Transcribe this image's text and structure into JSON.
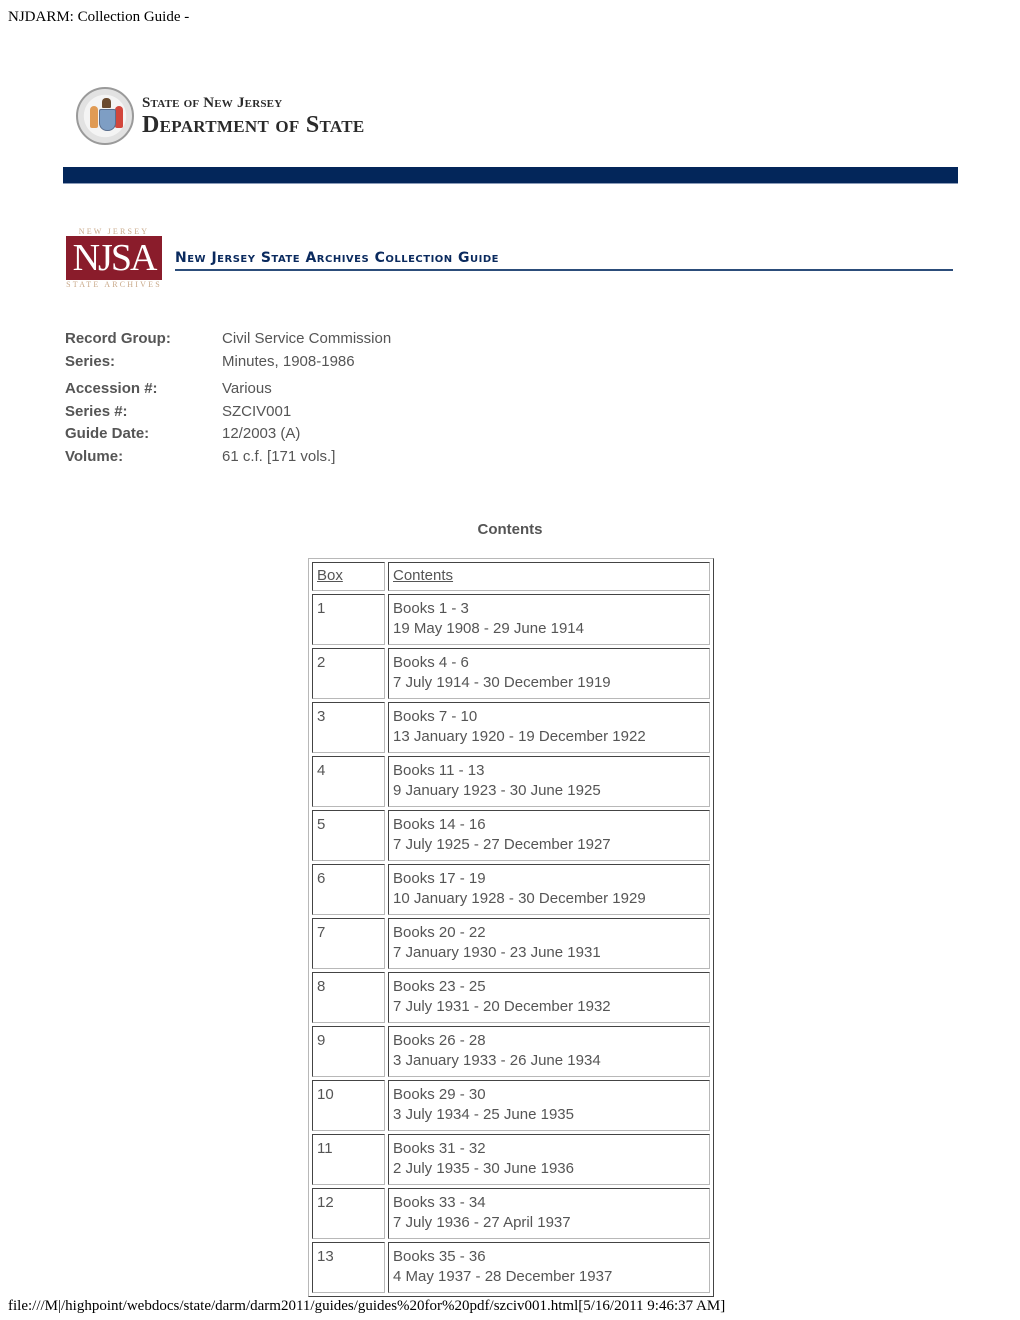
{
  "print_header": "NJDARM: Collection Guide -",
  "print_footer": "file:///M|/highpoint/webdocs/state/darm/darm2011/guides/guides%20for%20pdf/szciv001.html[5/16/2011 9:46:37 AM]",
  "dept_logo": {
    "line1": "State of New Jersey",
    "line2": "Department of State",
    "seal_icon": "nj-state-seal-icon"
  },
  "njsa_logo": {
    "top": "NEW JERSEY",
    "mark": "NJSA",
    "bottom": "STATE ARCHIVES"
  },
  "guide_title": "New Jersey State Archives Collection Guide",
  "colors": {
    "banner": "#03265a",
    "title": "#0a2a5e",
    "njsa": "#8a1c2b"
  },
  "meta": [
    {
      "label": "Record Group:",
      "value": "Civil Service Commission"
    },
    {
      "label": "Series:",
      "value": "Minutes, 1908-1986"
    },
    {
      "label": "Accession #:",
      "value": "Various"
    },
    {
      "label": "Series #:",
      "value": "SZCIV001"
    },
    {
      "label": "Guide Date:",
      "value": "12/2003 (A)"
    },
    {
      "label": "Volume:",
      "value": "61 c.f. [171 vols.]"
    }
  ],
  "contents_heading": "Contents",
  "table": {
    "headers": [
      "Box",
      "Contents"
    ],
    "rows": [
      {
        "box": "1",
        "books": "Books 1 - 3",
        "dates": "19 May 1908 - 29 June 1914"
      },
      {
        "box": "2",
        "books": "Books 4 - 6",
        "dates": "7 July 1914 - 30 December 1919"
      },
      {
        "box": "3",
        "books": "Books 7 - 10",
        "dates": "13 January 1920 - 19 December 1922"
      },
      {
        "box": "4",
        "books": "Books 11 - 13",
        "dates": "9 January 1923 - 30 June 1925"
      },
      {
        "box": "5",
        "books": "Books 14 - 16",
        "dates": "7 July 1925 - 27 December 1927"
      },
      {
        "box": "6",
        "books": "Books 17 - 19",
        "dates": "10 January 1928 - 30 December 1929"
      },
      {
        "box": "7",
        "books": "Books 20 - 22",
        "dates": "7 January 1930 - 23 June 1931"
      },
      {
        "box": "8",
        "books": "Books 23 - 25",
        "dates": "7 July 1931 - 20 December 1932"
      },
      {
        "box": "9",
        "books": "Books 26 - 28",
        "dates": "3 January 1933 - 26 June 1934"
      },
      {
        "box": "10",
        "books": "Books 29 - 30",
        "dates": "3 July 1934 - 25 June 1935"
      },
      {
        "box": "11",
        "books": "Books 31 - 32",
        "dates": "2 July 1935 - 30 June 1936"
      },
      {
        "box": "12",
        "books": "Books 33 - 34",
        "dates": "7 July 1936 - 27 April 1937"
      },
      {
        "box": "13",
        "books": "Books 35 - 36",
        "dates": "4 May 1937 - 28 December 1937"
      }
    ]
  }
}
